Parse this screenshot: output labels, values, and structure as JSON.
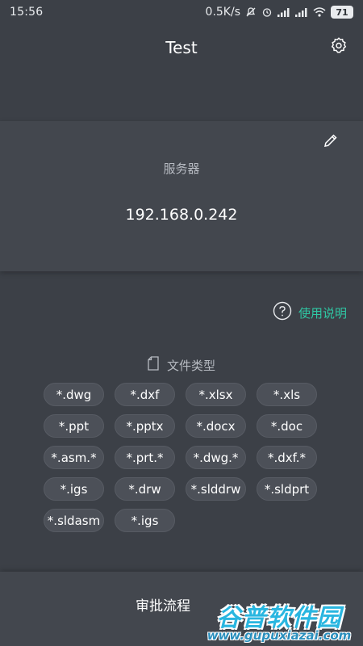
{
  "status_bar": {
    "time": "15:56",
    "net_speed": "0.5K/s",
    "battery": "71"
  },
  "header": {
    "title": "Test"
  },
  "server": {
    "label": "服务器",
    "address": "192.168.0.242"
  },
  "help": {
    "label": "使用说明"
  },
  "file_types": {
    "title": "文件类型",
    "tags": [
      "*.dwg",
      "*.dxf",
      "*.xlsx",
      "*.xls",
      "*.ppt",
      "*.pptx",
      "*.docx",
      "*.doc",
      "*.asm.*",
      "*.prt.*",
      "*.dwg.*",
      "*.dxf.*",
      "*.igs",
      "*.drw",
      "*.slddrw",
      "*.sldprt",
      "*.sldasm",
      "*.igs"
    ]
  },
  "bottom": {
    "approve_label": "审批流程"
  },
  "watermark": {
    "brand": "谷普软件园",
    "url": "www.gupuxiazai.com"
  },
  "colors": {
    "background": "#3c4047",
    "card": "#43474e",
    "accent": "#2fc7a4",
    "tag": "#4c5058"
  },
  "icons": {
    "settings": "gear-icon",
    "edit": "pencil-icon",
    "help": "question-circle-icon",
    "file_type": "document-icon"
  }
}
